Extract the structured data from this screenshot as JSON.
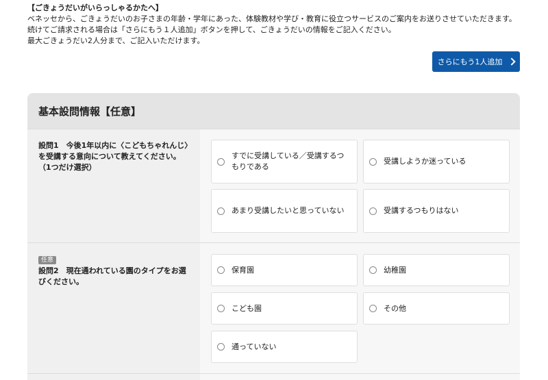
{
  "intro": {
    "title": "【ごきょうだいがいらっしゃるかたへ】",
    "line1": "ベネッセから、ごきょうだいのお子さまの年齢・学年にあった、体験教材や学び・教育に役立つサービスのご案内をお送りさせていただきます。",
    "line2": "続けてご請求される場合は「さらにもう１人追加」ボタンを押して、ごきょうだいの情報をご記入ください。",
    "line3": "最大ごきょうだい2人分まで、ご記入いただけます。"
  },
  "add_button": {
    "label": "さらにもう1人追加"
  },
  "section": {
    "title": "基本設問情報【任意】"
  },
  "q1": {
    "text": "設問1　今後1年以内に〈こどもちゃれんじ〉を受講する意向について教えてください。（1つだけ選択）",
    "options": [
      "すでに受講している／受講するつもりである",
      "受講しようか迷っている",
      "あまり受講したいと思っていない",
      "受講するつもりはない"
    ]
  },
  "q2": {
    "badge": "任意",
    "text": "設問2　現在通われている園のタイプをお選びください。",
    "options": [
      "保育園",
      "幼稚園",
      "こども園",
      "その他",
      "通っていない"
    ]
  },
  "colors": {
    "accent": "#0e5aa8",
    "header_bg": "#e4e4e4",
    "question_bg": "#f0f0f0"
  }
}
